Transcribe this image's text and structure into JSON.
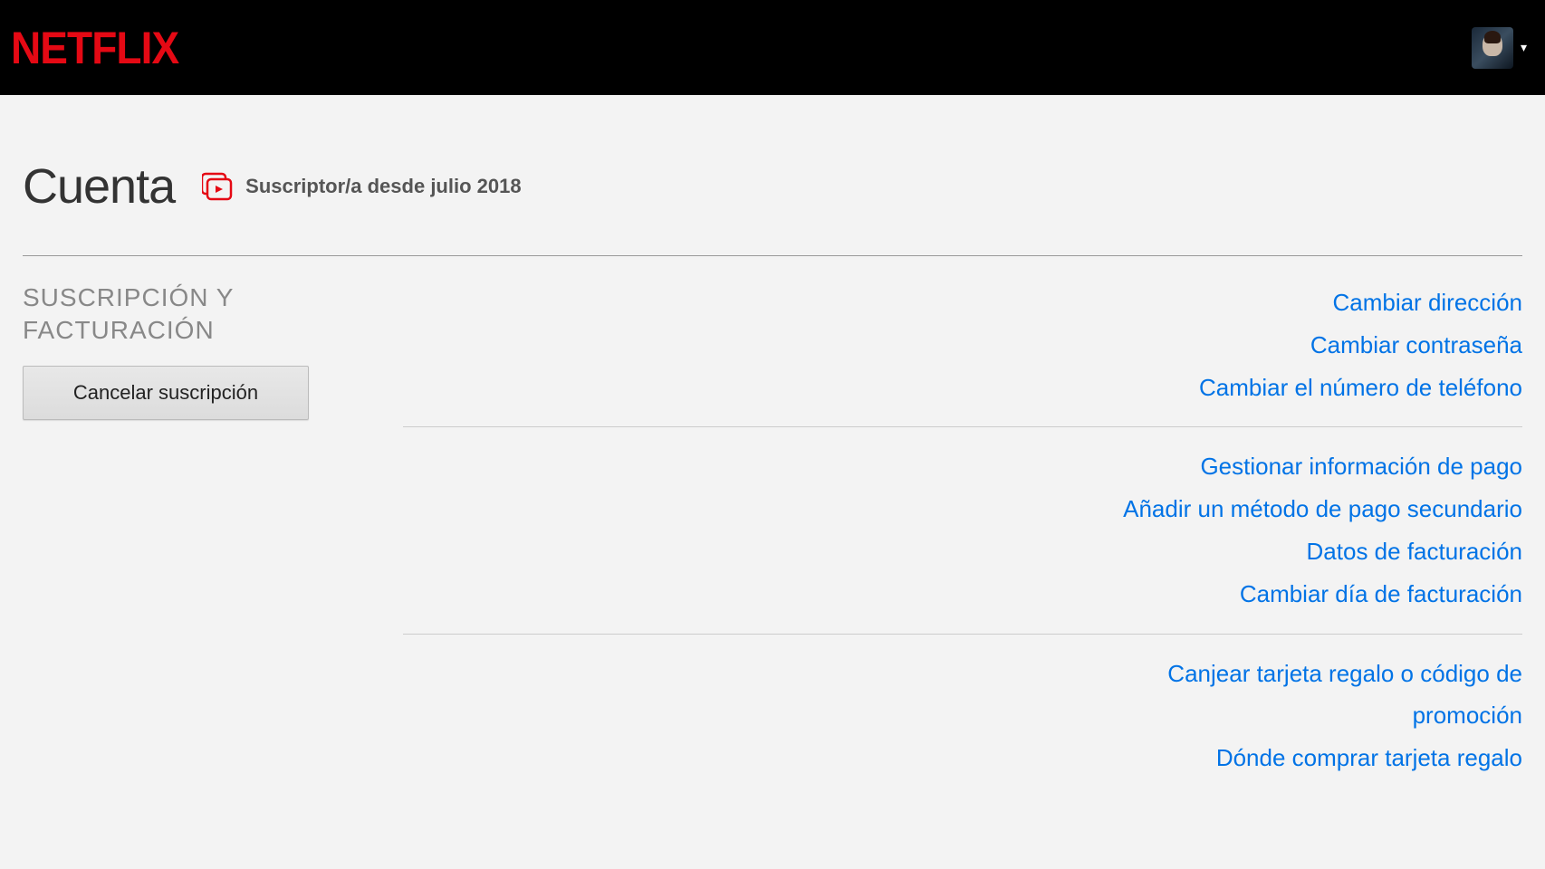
{
  "brand": "NETFLIX",
  "page": {
    "title": "Cuenta",
    "member_since": "Suscriptor/a desde julio 2018"
  },
  "section": {
    "title": "SUSCRIPCIÓN Y FACTURACIÓN",
    "cancel_button": "Cancelar suscripción"
  },
  "links": {
    "group1": {
      "change_address": "Cambiar dirección",
      "change_password": "Cambiar contraseña",
      "change_phone": "Cambiar el número de teléfono"
    },
    "group2": {
      "manage_payment": "Gestionar información de pago",
      "add_secondary": "Añadir un método de pago secundario",
      "billing_details": "Datos de facturación",
      "change_billing_day": "Cambiar día de facturación"
    },
    "group3": {
      "redeem_gift": "Canjear tarjeta regalo o código de promoción",
      "where_buy_gift": "Dónde comprar tarjeta regalo"
    }
  }
}
